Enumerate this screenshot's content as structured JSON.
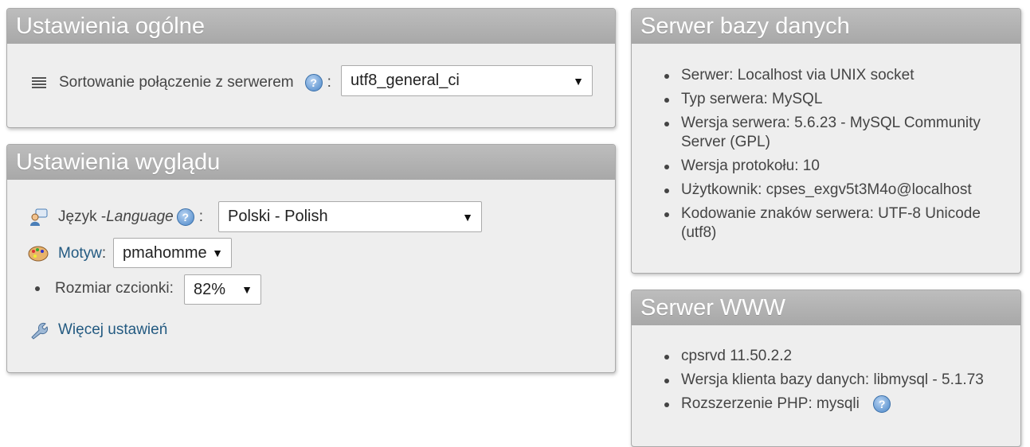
{
  "general": {
    "title": "Ustawienia ogólne",
    "collation_label": "Sortowanie połączenie z serwerem",
    "collation_colon": ":",
    "collation_value": "utf8_general_ci"
  },
  "appearance": {
    "title": "Ustawienia wyglądu",
    "language_label": "Język - ",
    "language_label_en": "Language",
    "language_colon": ":",
    "language_value": "Polski - Polish",
    "theme_label": "Motyw",
    "theme_colon": ":",
    "theme_value": "pmahomme",
    "font_label": "Rozmiar czcionki:",
    "font_value": "82%",
    "more_settings": "Więcej ustawień"
  },
  "db_server": {
    "title": "Serwer bazy danych",
    "items": [
      "Serwer: Localhost via UNIX socket",
      "Typ serwera: MySQL",
      "Wersja serwera: 5.6.23 - MySQL Community Server (GPL)",
      "Wersja protokołu: 10",
      "Użytkownik: cpses_exgv5t3M4o@localhost",
      "Kodowanie znaków serwera: UTF-8 Unicode (utf8)"
    ]
  },
  "web_server": {
    "title": "Serwer WWW",
    "items": [
      "cpsrvd 11.50.2.2",
      "Wersja klienta bazy danych: libmysql - 5.1.73",
      "Rozszerzenie PHP: mysqli"
    ]
  },
  "icons": {
    "collation": "list-icon",
    "help": "help-icon",
    "language": "language-icon",
    "theme": "palette-icon",
    "settings": "wrench-icon"
  },
  "colors": {
    "header_bg": "#afafaf",
    "panel_bg": "#eeeeee",
    "link": "#235a81"
  }
}
